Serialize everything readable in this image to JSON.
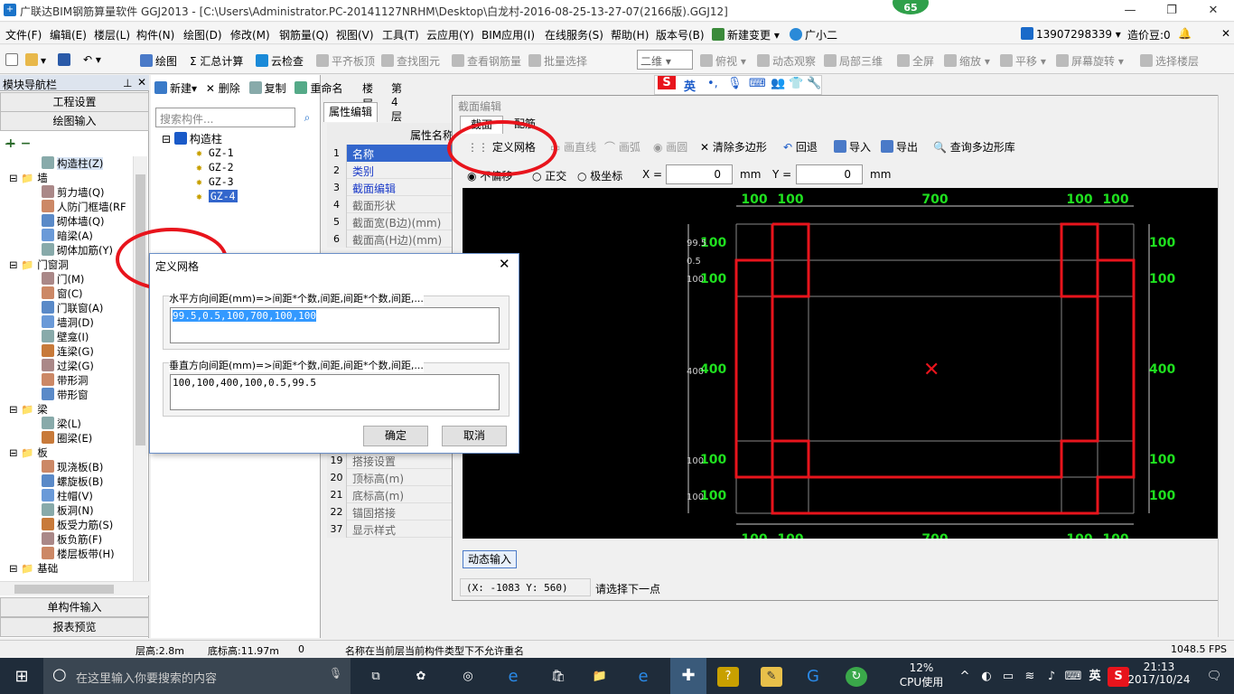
{
  "window": {
    "title": "广联达BIM钢筋算量软件 GGJ2013 - [C:\\Users\\Administrator.PC-20141127NRHM\\Desktop\\白龙村-2016-08-25-13-27-07(2166版).GGJ12]",
    "badge": "65"
  },
  "menu": [
    "文件(F)",
    "编辑(E)",
    "楼层(L)",
    "构件(N)",
    "绘图(D)",
    "修改(M)",
    "钢筋量(Q)",
    "视图(V)",
    "工具(T)",
    "云应用(Y)",
    "BIM应用(I)",
    "在线服务(S)",
    "帮助(H)",
    "版本号(B)",
    "新建变更",
    "广小二"
  ],
  "account": {
    "phone": "13907298339",
    "price": "造价豆:0"
  },
  "toolbar": [
    "绘图",
    "汇总计算",
    "云检查",
    "平齐板顶",
    "查找图元",
    "查看钢筋量",
    "批量选择",
    "二维",
    "俯视",
    "动态观察",
    "局部三维",
    "全屏",
    "缩放",
    "平移",
    "屏幕旋转",
    "选择楼层"
  ],
  "left": {
    "header": "模块导航栏",
    "btn_project": "工程设置",
    "btn_draw": "绘图输入",
    "tree": [
      "构造柱(Z)",
      "墙",
      "剪力墙(Q)",
      "人防门框墙(RF",
      "砌体墙(Q)",
      "暗梁(A)",
      "砌体加筋(Y)",
      "门窗洞",
      "门(M)",
      "窗(C)",
      "门联窗(A)",
      "墙洞(D)",
      "壁龛(I)",
      "连梁(G)",
      "过梁(G)",
      "带形洞",
      "带形窗",
      "梁",
      "梁(L)",
      "圈梁(E)",
      "板",
      "现浇板(B)",
      "螺旋板(B)",
      "柱帽(V)",
      "板洞(N)",
      "板受力筋(S)",
      "板负筋(F)",
      "楼层板带(H)",
      "基础"
    ],
    "btn_single": "单构件输入",
    "btn_report": "报表预览"
  },
  "mid": {
    "toolbar": [
      "新建",
      "删除",
      "复制",
      "重命名",
      "楼层",
      "第4层"
    ],
    "search_placeholder": "搜索构件...",
    "root": "构造柱",
    "items": [
      "GZ-1",
      "GZ-2",
      "GZ-3",
      "GZ-4"
    ]
  },
  "props": {
    "tab": "属性编辑",
    "header": "属性名称",
    "rows": [
      {
        "n": "1",
        "l": "名称"
      },
      {
        "n": "2",
        "l": "类别"
      },
      {
        "n": "3",
        "l": "截面编辑"
      },
      {
        "n": "4",
        "l": "截面形状"
      },
      {
        "n": "5",
        "l": "截面宽(B边)(mm)"
      },
      {
        "n": "6",
        "l": "截面高(H边)(mm)"
      }
    ],
    "rows_low": [
      {
        "n": "19",
        "l": "搭接设置"
      },
      {
        "n": "20",
        "l": "顶标高(m)"
      },
      {
        "n": "21",
        "l": "底标高(m)"
      },
      {
        "n": "22",
        "l": "锚固搭接"
      },
      {
        "n": "37",
        "l": "显示样式"
      }
    ]
  },
  "cad": {
    "title": "截面编辑",
    "tabs": [
      "截面",
      "配筋"
    ],
    "tools": [
      "定义网格",
      "画直线",
      "画弧",
      "画圆",
      "清除多边形",
      "回退",
      "导入",
      "导出",
      "查询多边形库"
    ],
    "coord_opts": [
      "不偏移",
      "正交",
      "极坐标"
    ],
    "x_label": "X =",
    "x_val": "0",
    "y_label": "Y =",
    "y_val": "0",
    "unit": "mm",
    "dyn_input": "动态输入",
    "coords": "(X: -1083 Y: 560)",
    "hint": "请选择下一点",
    "top_dims": [
      "100",
      "100",
      "700",
      "100",
      "100"
    ],
    "bottom_dims": [
      "100",
      "100",
      "700",
      "100",
      "100"
    ],
    "bottom_small": [
      "99.5",
      "0.5",
      "100",
      "700",
      "100",
      "100"
    ],
    "right_dims": [
      "100",
      "100",
      "400",
      "100",
      "100"
    ],
    "left_dims": [
      "99.5",
      "0.5",
      "100",
      "100",
      "400",
      "100",
      "100"
    ],
    "left_overlay": [
      "100",
      "100",
      "400",
      "100",
      "100"
    ]
  },
  "dialog": {
    "title": "定义网格",
    "h_label": "水平方向间距(mm)=>间距*个数,间距,间距*个数,间距,...",
    "h_value": "99.5,0.5,100,700,100,100",
    "v_label": "垂直方向间距(mm)=>间距*个数,间距,间距*个数,间距,...",
    "v_value": "100,100,400,100,0.5,99.5",
    "ok": "确定",
    "cancel": "取消"
  },
  "status": {
    "floor_h": "层高:2.8m",
    "base_h": "底标高:11.97m",
    "zero": "0",
    "msg": "名称在当前层当前构件类型下不允许重名",
    "fps": "1048.5 FPS"
  },
  "taskbar": {
    "search": "在这里输入你要搜索的内容",
    "cpu": "12%",
    "cpu_label": "CPU使用",
    "ime": "英",
    "time": "21:13",
    "date": "2017/10/24"
  },
  "colors": {
    "accent": "#e8141c",
    "dim": "#1fe01f",
    "select": "#3366cc"
  }
}
